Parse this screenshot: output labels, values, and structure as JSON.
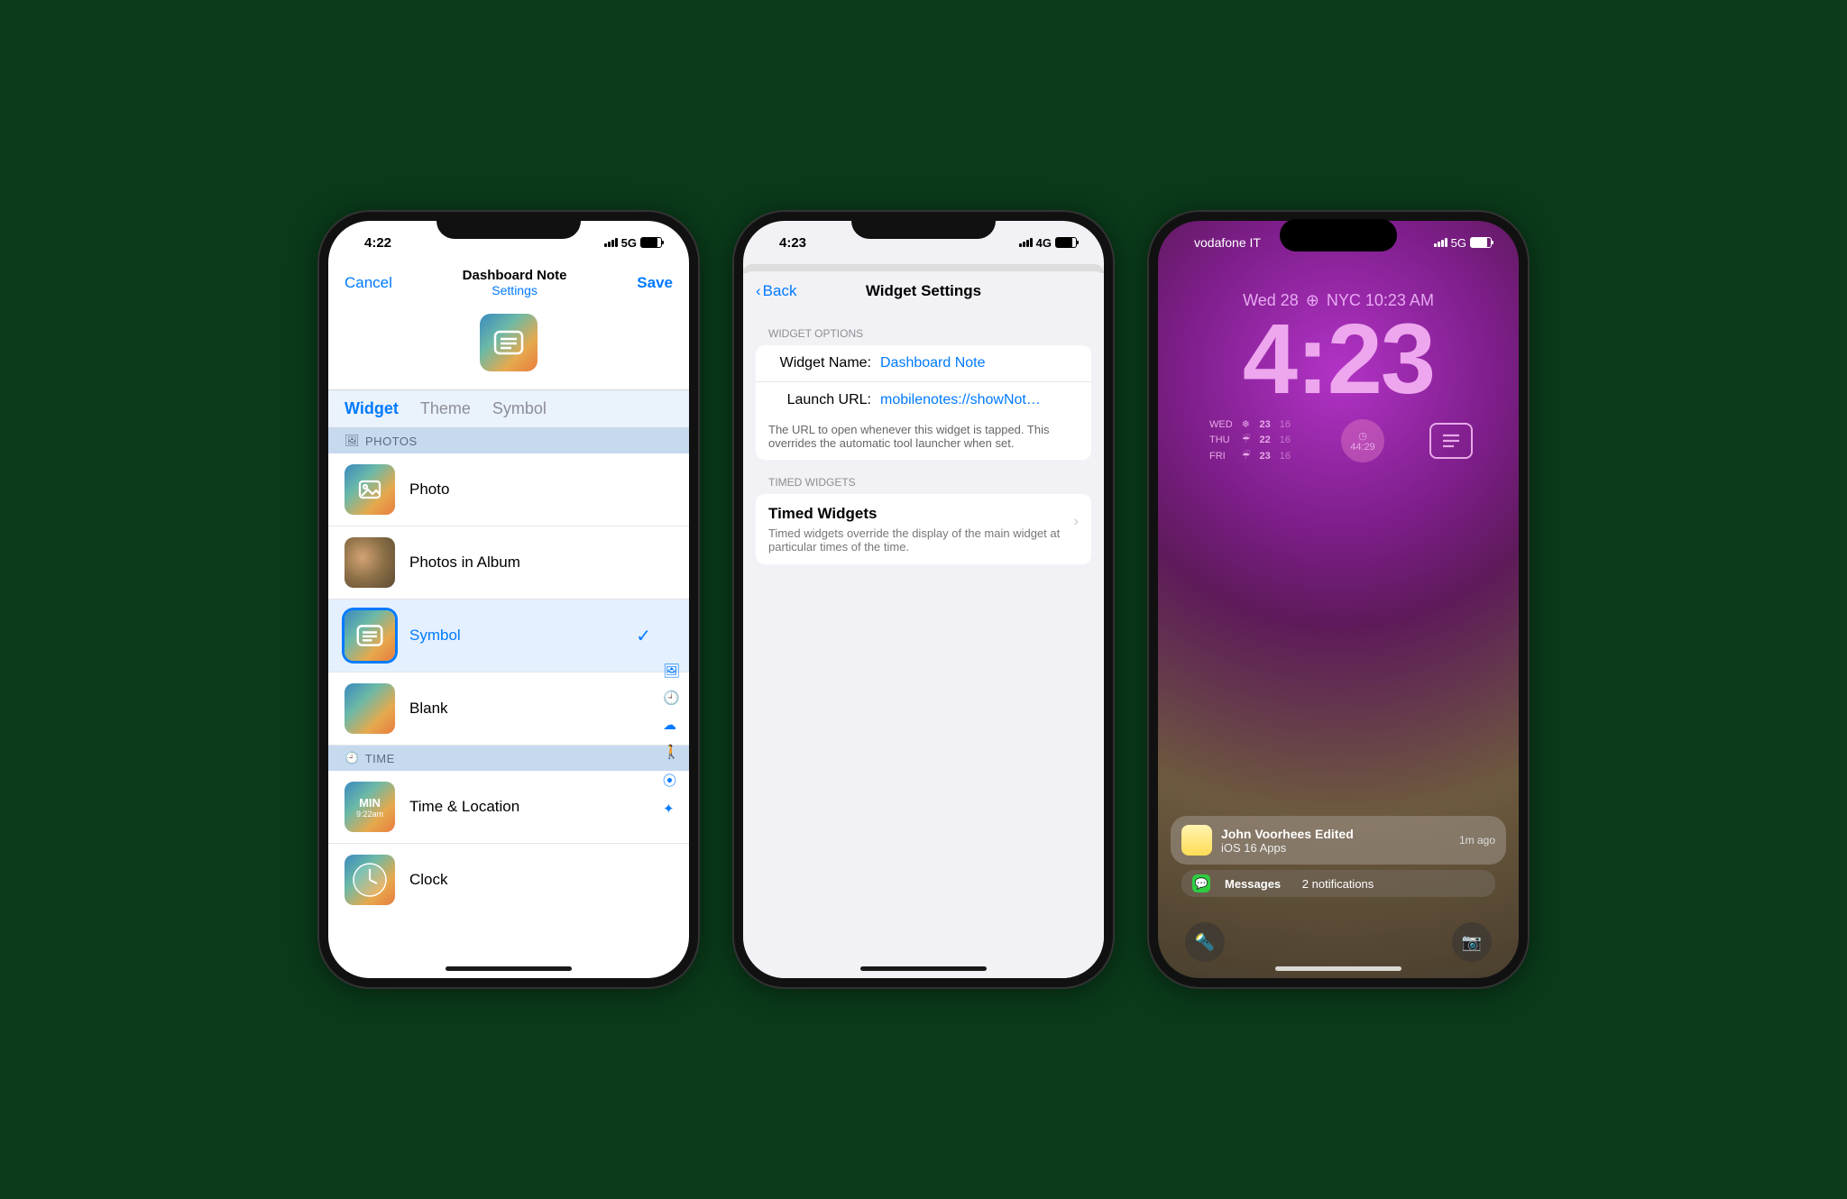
{
  "phone1": {
    "status": {
      "time": "4:22",
      "network": "5G"
    },
    "nav": {
      "cancel": "Cancel",
      "title": "Dashboard Note",
      "subtitle": "Settings",
      "save": "Save"
    },
    "tabs": {
      "widget": "Widget",
      "theme": "Theme",
      "symbol": "Symbol"
    },
    "sections": {
      "photos": "PHOTOS",
      "time": "TIME"
    },
    "rows": {
      "photo": "Photo",
      "photos_album": "Photos in Album",
      "symbol": "Symbol",
      "blank": "Blank",
      "time_location": "Time & Location",
      "clock": "Clock",
      "min_label": "MIN",
      "min_time": "9:22am"
    }
  },
  "phone2": {
    "status": {
      "time": "4:23",
      "network": "4G"
    },
    "nav": {
      "back": "Back",
      "title": "Widget Settings"
    },
    "group1": "WIDGET OPTIONS",
    "fields": {
      "name_label": "Widget Name:",
      "name_value": "Dashboard Note",
      "url_label": "Launch URL:",
      "url_value": "mobilenotes://showNot…",
      "url_caption": "The URL to open whenever this widget is tapped. This overrides the automatic tool launcher when set."
    },
    "group2": "TIMED WIDGETS",
    "timed": {
      "title": "Timed Widgets",
      "desc": "Timed widgets override the display of the main widget at particular times of the time."
    }
  },
  "phone3": {
    "status": {
      "carrier": "vodafone IT",
      "network": "5G"
    },
    "date": {
      "day": "Wed 28",
      "loc": "NYC 10:23 AM"
    },
    "big_time": "4:23",
    "weather": [
      {
        "day": "WED",
        "hi": "23",
        "lo": "16"
      },
      {
        "day": "THU",
        "hi": "22",
        "lo": "16"
      },
      {
        "day": "FRI",
        "hi": "23",
        "lo": "16"
      }
    ],
    "timer": "44:29",
    "notif1": {
      "title": "John Voorhees Edited",
      "sub": "iOS 16 Apps",
      "time": "1m ago"
    },
    "notif2": {
      "app": "Messages",
      "count": "2 notifications"
    }
  }
}
